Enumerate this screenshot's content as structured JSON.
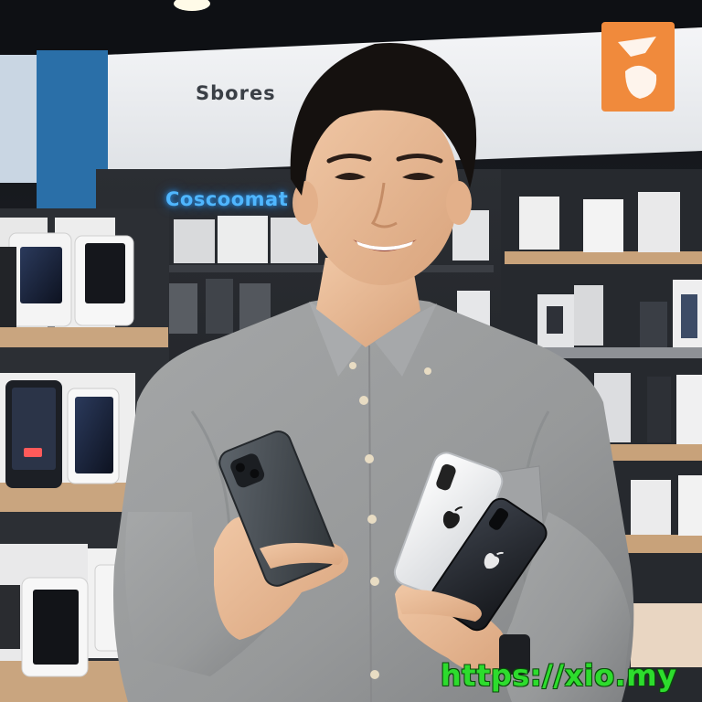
{
  "scene": {
    "store_sign_text": "Sbores",
    "neon_sign_text": "Coscoomat",
    "watermark_text": "https://xio.my"
  },
  "colors": {
    "shirt": "#9c9e9f",
    "wall_white": "#eef0f2",
    "blue_panel": "#2a6fa8",
    "logo_orange": "#f08a3c",
    "watermark_green": "#2ddc2d"
  },
  "icons": [
    "apple-logo-icon",
    "store-logo-icon"
  ]
}
